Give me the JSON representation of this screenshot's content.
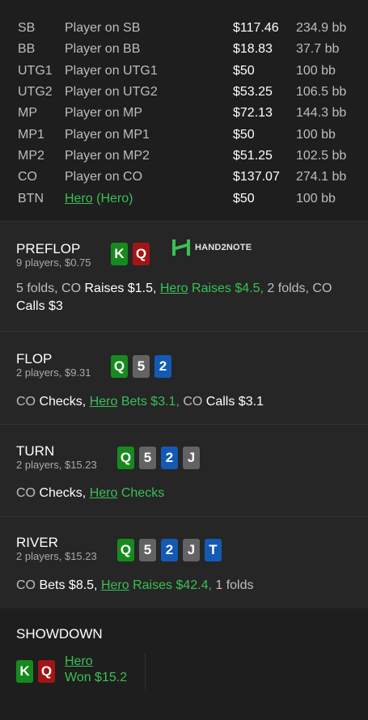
{
  "players": [
    {
      "pos": "SB",
      "name": "Player on SB",
      "stack": "$117.46",
      "bb": "234.9 bb"
    },
    {
      "pos": "BB",
      "name": "Player on BB",
      "stack": "$18.83",
      "bb": "37.7 bb"
    },
    {
      "pos": "UTG1",
      "name": "Player on UTG1",
      "stack": "$50",
      "bb": "100 bb"
    },
    {
      "pos": "UTG2",
      "name": "Player on UTG2",
      "stack": "$53.25",
      "bb": "106.5 bb"
    },
    {
      "pos": "MP",
      "name": "Player on MP",
      "stack": "$72.13",
      "bb": "144.3 bb"
    },
    {
      "pos": "MP1",
      "name": "Player on MP1",
      "stack": "$50",
      "bb": "100 bb"
    },
    {
      "pos": "MP2",
      "name": "Player on MP2",
      "stack": "$51.25",
      "bb": "102.5 bb"
    },
    {
      "pos": "CO",
      "name": "Player on CO",
      "stack": "$137.07",
      "bb": "274.1 bb"
    }
  ],
  "hero_row": {
    "pos": "BTN",
    "name_link": "Hero",
    "name_suffix": " (Hero)",
    "stack": "$50",
    "bb": "100 bb"
  },
  "logo": {
    "text": "HAND2NOTE"
  },
  "preflop": {
    "title": "PREFLOP",
    "sub": "9 players, $0.75",
    "cards": [
      {
        "rank": "K",
        "color": "green"
      },
      {
        "rank": "Q",
        "color": "red"
      }
    ],
    "a1": "5 folds, CO ",
    "a2": "Raises $1.5, ",
    "a3": "Hero",
    "a4": " Raises $4.5,",
    "a5": " 2 folds, CO",
    "a6": "Calls $3"
  },
  "flop": {
    "title": "FLOP",
    "sub": "2 players, $9.31",
    "cards": [
      {
        "rank": "Q",
        "color": "green"
      },
      {
        "rank": "5",
        "color": "grey"
      },
      {
        "rank": "2",
        "color": "blue"
      }
    ],
    "a1": "CO ",
    "a2": "Checks, ",
    "a3": "Hero",
    "a4": " Bets $3.1,",
    "a5": " CO ",
    "a6": "Calls $3.1"
  },
  "turn": {
    "title": "TURN",
    "sub": "2 players, $15.23",
    "cards": [
      {
        "rank": "Q",
        "color": "green"
      },
      {
        "rank": "5",
        "color": "grey"
      },
      {
        "rank": "2",
        "color": "blue"
      },
      {
        "rank": "J",
        "color": "grey"
      }
    ],
    "a1": "CO ",
    "a2": "Checks, ",
    "a3": "Hero",
    "a4": " Checks"
  },
  "river": {
    "title": "RIVER",
    "sub": "2 players, $15.23",
    "cards": [
      {
        "rank": "Q",
        "color": "green"
      },
      {
        "rank": "5",
        "color": "grey"
      },
      {
        "rank": "2",
        "color": "blue"
      },
      {
        "rank": "J",
        "color": "grey"
      },
      {
        "rank": "T",
        "color": "blue"
      }
    ],
    "a1": "CO ",
    "a2": "Bets $8.5, ",
    "a3": "Hero",
    "a4": " Raises $42.4,",
    "a5": " 1 folds"
  },
  "showdown": {
    "title": "SHOWDOWN",
    "cards": [
      {
        "rank": "K",
        "color": "green"
      },
      {
        "rank": "Q",
        "color": "red"
      }
    ],
    "winner": "Hero",
    "won": "Won $15.2"
  },
  "colors": {
    "green_card": "#178a1f",
    "red_card": "#a31515",
    "grey_card": "#636363",
    "blue_card": "#1459b3",
    "hero_green": "#3bbf55"
  }
}
